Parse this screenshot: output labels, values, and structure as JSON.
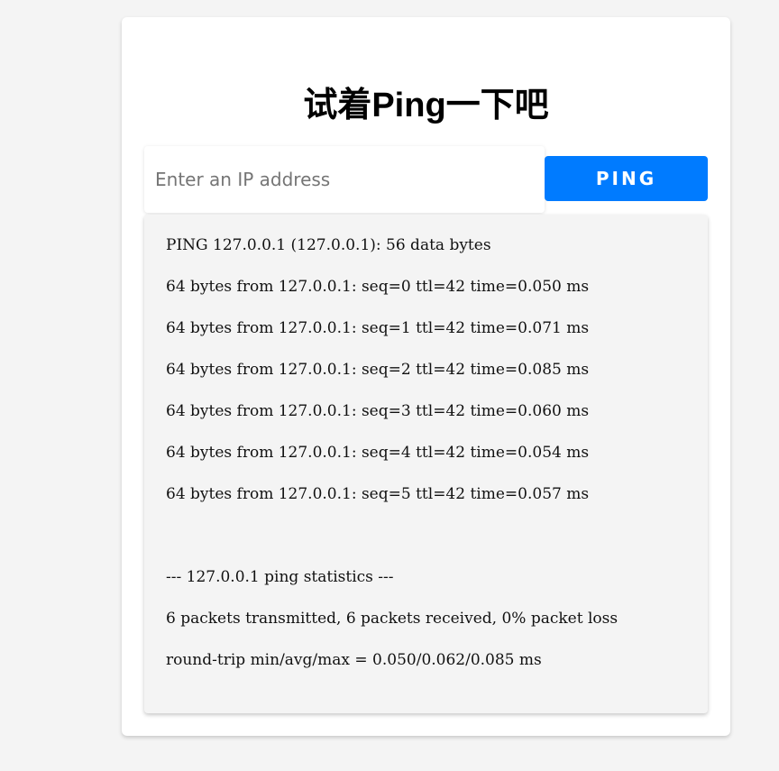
{
  "title": "试着Ping一下吧",
  "input": {
    "placeholder": "Enter an IP address",
    "value": ""
  },
  "button": {
    "label": "PING"
  },
  "colors": {
    "button_bg": "#007bff",
    "page_bg": "#f4f4f4",
    "output_bg": "#f4f4f4"
  },
  "output": {
    "lines": [
      "PING 127.0.0.1 (127.0.0.1): 56 data bytes",
      "64 bytes from 127.0.0.1: seq=0 ttl=42 time=0.050 ms",
      "64 bytes from 127.0.0.1: seq=1 ttl=42 time=0.071 ms",
      "64 bytes from 127.0.0.1: seq=2 ttl=42 time=0.085 ms",
      "64 bytes from 127.0.0.1: seq=3 ttl=42 time=0.060 ms",
      "64 bytes from 127.0.0.1: seq=4 ttl=42 time=0.054 ms",
      "64 bytes from 127.0.0.1: seq=5 ttl=42 time=0.057 ms",
      "",
      "--- 127.0.0.1 ping statistics ---",
      "6 packets transmitted, 6 packets received, 0% packet loss",
      "round-trip min/avg/max = 0.050/0.062/0.085 ms"
    ]
  }
}
